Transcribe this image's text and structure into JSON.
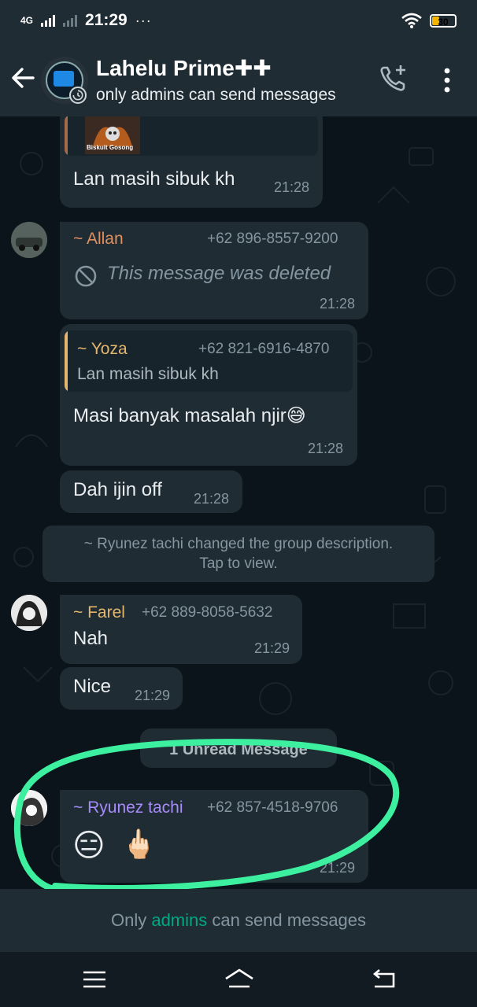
{
  "status_bar": {
    "network": "4G",
    "time": "21:29",
    "more": "···",
    "battery": "30"
  },
  "header": {
    "title": "Lahelu Prime✚✚",
    "subtitle": "only admins can send messages",
    "avatar_icon": "group-avatar",
    "actions": [
      "back-arrow-icon",
      "add-call-icon",
      "more-vert-icon"
    ]
  },
  "messages": [
    {
      "quote_thumb_caption": "Biskuit Gosong",
      "text": "Lan masih sibuk kh",
      "time": "21:28"
    },
    {
      "sender": "~ Allan",
      "phone": "+62 896-8557-9200",
      "text": "This message was deleted",
      "time": "21:28"
    },
    {
      "quote_sender": "~ Yoza",
      "quote_phone": "+62 821-6916-4870",
      "quote_text": "Lan masih sibuk kh",
      "text": "Masi banyak masalah njir",
      "emoji": "😅",
      "time": "21:28"
    },
    {
      "text": "Dah ijin off",
      "time": "21:28"
    },
    {
      "sender": "~ Farel",
      "phone": "+62 889-8058-5632",
      "text": "Nah",
      "time": "21:29"
    },
    {
      "text": "Nice",
      "time": "21:29"
    },
    {
      "sender": "~ Ryunez tachi",
      "phone": "+62 857-4518-9706",
      "emoji_1": "😑",
      "emoji_2": "🖕🏻",
      "time": "21:29"
    }
  ],
  "system_message": {
    "line1": "~ Ryunez tachi changed the group description.",
    "line2": "Tap to view."
  },
  "unread_divider": "1 Unread Message",
  "footer": {
    "prefix": "Only ",
    "admins": "admins",
    "suffix": " can send messages"
  },
  "colors": {
    "background": "#0b141a",
    "bubble": "#1f2c34",
    "accent": "#00a884",
    "allan": "#e0905f",
    "yoza": "#e5b66b",
    "farel": "#e5b66b",
    "ryunez": "#a78bfa",
    "highlight": "#3cf0a0"
  }
}
